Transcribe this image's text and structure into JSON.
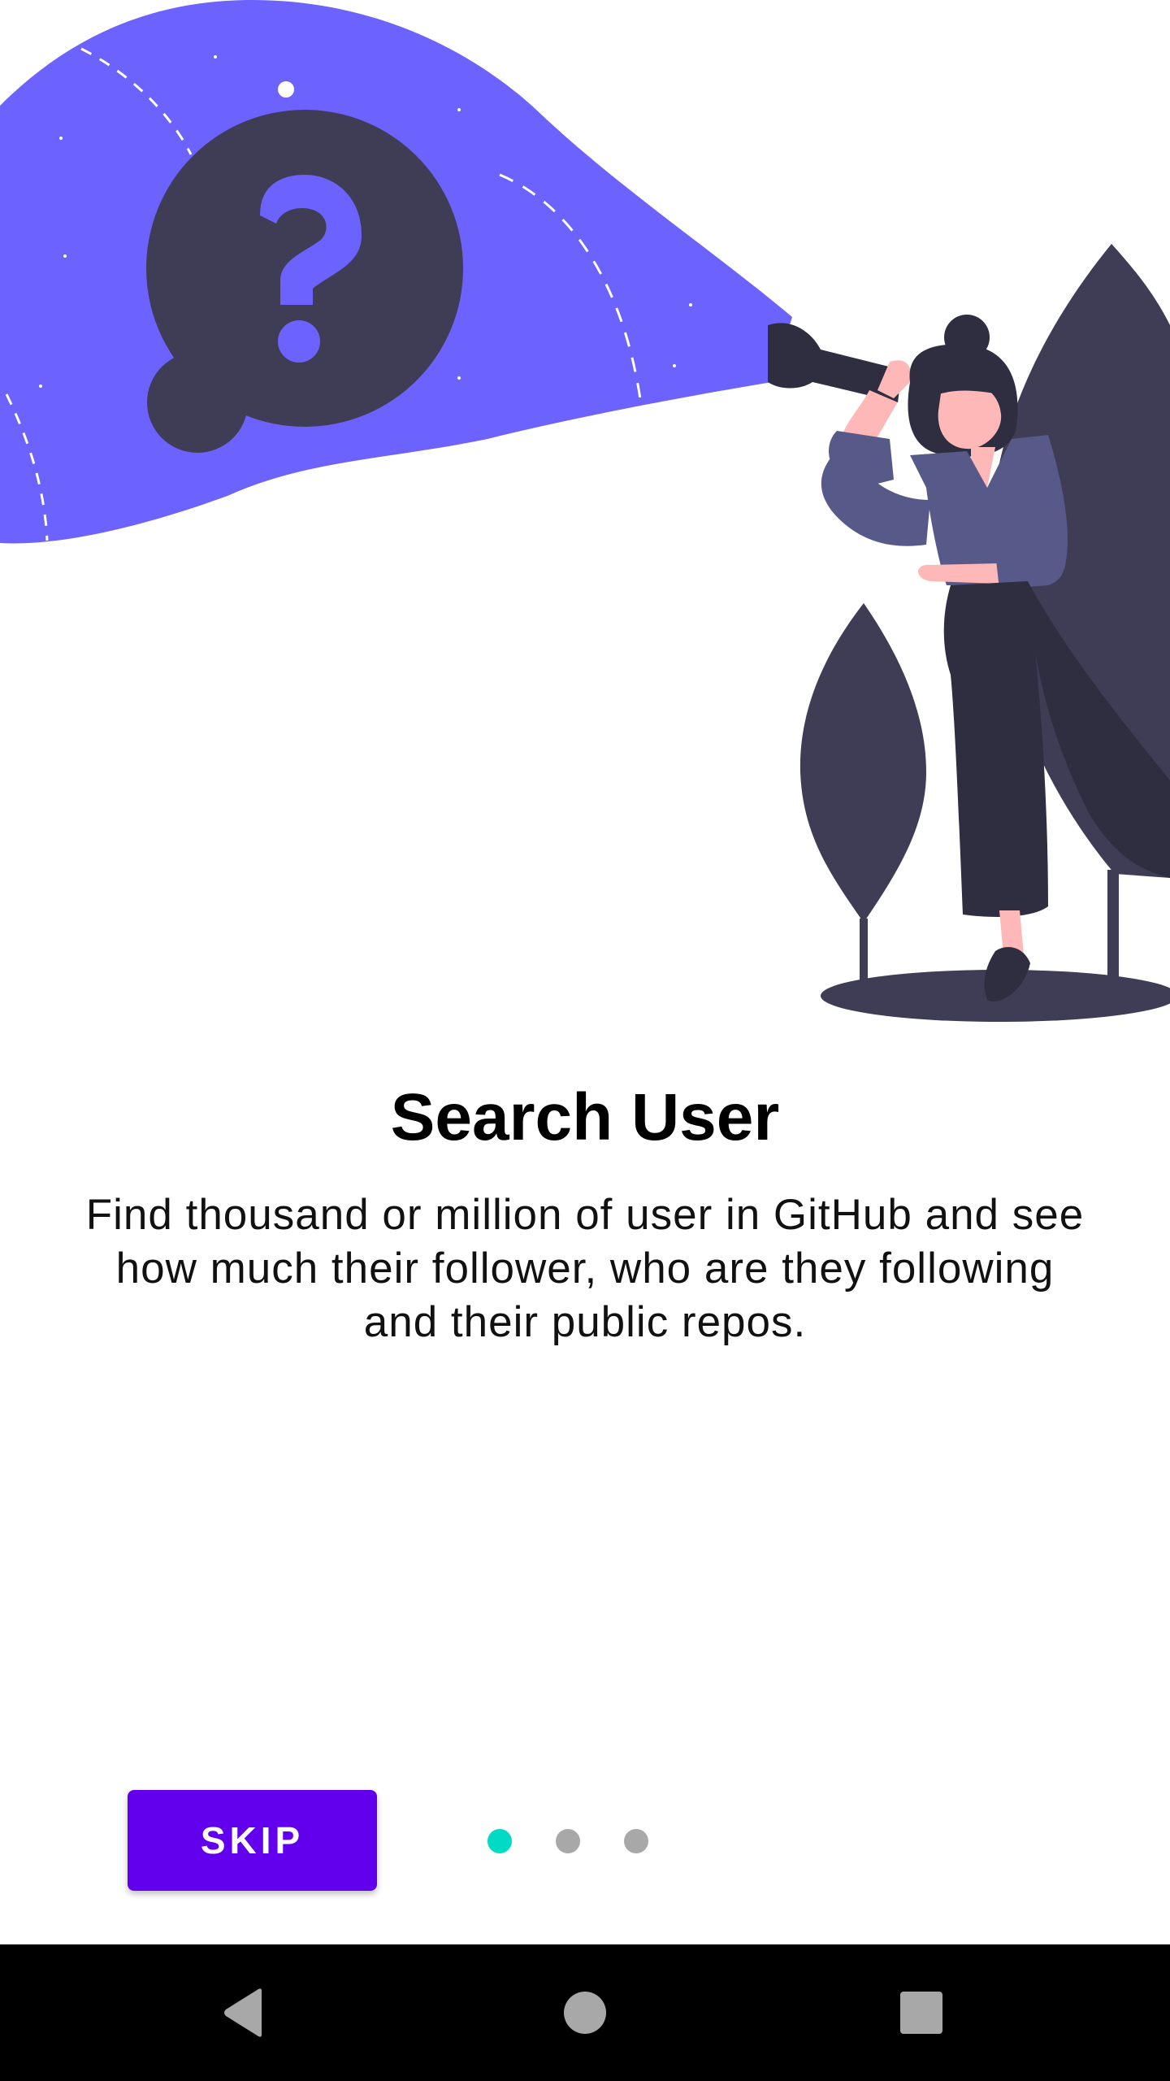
{
  "onboarding": {
    "title": "Search User",
    "description": "Find thousand or million of user in GitHub and see how much their follower, who are they following and their public repos.",
    "skip_label": "SKIP",
    "page_indicator": {
      "count": 3,
      "active_index": 0
    }
  },
  "illustration": {
    "icon": "question-mark-icon",
    "subject": "woman-with-flashlight"
  },
  "navigation_bar": {
    "back_icon": "back-triangle-icon",
    "home_icon": "home-circle-icon",
    "recents_icon": "recents-square-icon"
  },
  "colors": {
    "accent": "#6200ee",
    "indicator_active": "#03dac5",
    "indicator_inactive": "#a8a8a8",
    "beam": "#6c63ff",
    "dark_shape": "#3f3d56"
  }
}
